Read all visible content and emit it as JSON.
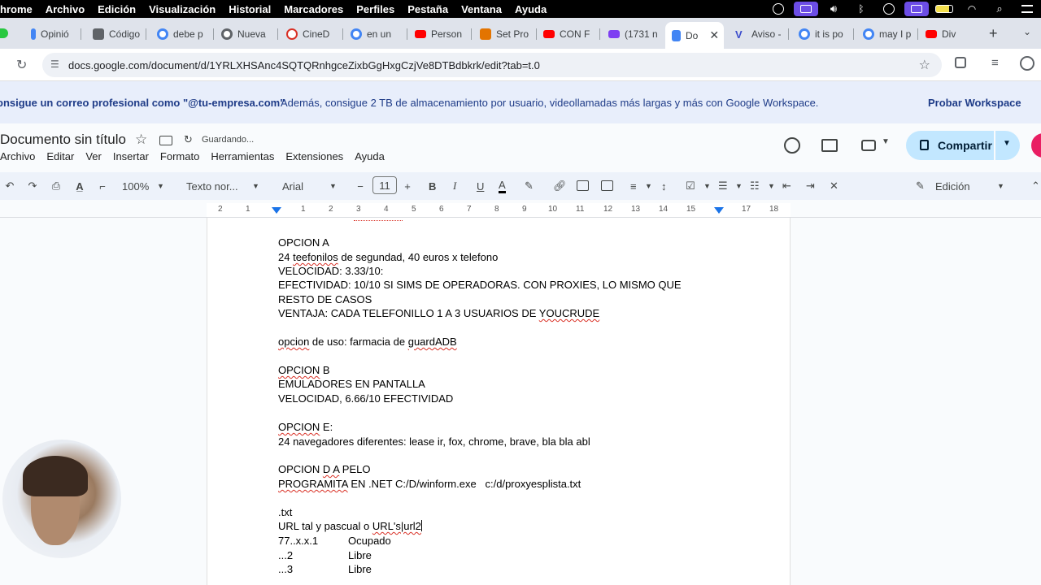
{
  "menubar": {
    "app": "hrome",
    "items": [
      "Archivo",
      "Edición",
      "Visualización",
      "Historial",
      "Marcadores",
      "Perfiles",
      "Pestaña",
      "Ventana",
      "Ayuda"
    ]
  },
  "tabs": [
    {
      "label": "Opinió",
      "color": "#4285f4"
    },
    {
      "label": "Código",
      "color": "#5f6368"
    },
    {
      "label": "debe p",
      "color": "#4285f4"
    },
    {
      "label": "Nueva",
      "color": "#5f6368"
    },
    {
      "label": "CineD",
      "color": "#d93025"
    },
    {
      "label": "en un",
      "color": "#4285f4"
    },
    {
      "label": "Person",
      "color": "#ff0000"
    },
    {
      "label": "Set Pro",
      "color": "#e37400"
    },
    {
      "label": "CON F",
      "color": "#ff0000"
    },
    {
      "label": "(1731 n",
      "color": "#7e3ff2"
    },
    {
      "label": "Do",
      "color": "#4285f4",
      "active": true
    },
    {
      "label": "Aviso -",
      "color": "#3c4dcc"
    },
    {
      "label": "it is po",
      "color": "#4285f4"
    },
    {
      "label": "may I p",
      "color": "#4285f4"
    },
    {
      "label": "Div",
      "color": "#ff0000"
    }
  ],
  "address": {
    "url": "docs.google.com/document/d/1YRLXHSAnc4SQTQRnhgceZixbGgHxgCzjVe8DTBdbkrk/edit?tab=t.0"
  },
  "banner": {
    "bold": "onsigue un correo profesional como \"@tu-empresa.com\"",
    "text": "Además, consigue 2 TB de almacenamiento por usuario, videollamadas más largas y más con Google Workspace.",
    "cta": "Probar Workspace"
  },
  "doc": {
    "title": "Documento sin título",
    "status": "Guardando...",
    "menu": [
      "Archivo",
      "Editar",
      "Ver",
      "Insertar",
      "Formato",
      "Herramientas",
      "Extensiones",
      "Ayuda"
    ],
    "share": "Compartir"
  },
  "toolbar": {
    "zoom": "100%",
    "style": "Texto nor...",
    "font": "Arial",
    "size": "11",
    "mode": "Edición"
  },
  "ruler": [
    "2",
    "1",
    "1",
    "2",
    "3",
    "4",
    "5",
    "6",
    "7",
    "8",
    "9",
    "10",
    "11",
    "12",
    "13",
    "14",
    "15",
    "16",
    "17",
    "18"
  ],
  "body": {
    "l1": "OPCION A",
    "l2a": "24 ",
    "l2b": "teefonilos",
    "l2c": " de segundad, 40 euros x telefono",
    "l3": "VELOCIDAD: 3.33/10:",
    "l4": "EFECTIVIDAD: 10/10 SI SIMS DE OPERADORAS. CON PROXIES, LO MISMO QUE",
    "l5": "RESTO DE CASOS",
    "l6a": "VENTAJA: CADA TELEFONILLO 1 A 3 USUARIOS DE ",
    "l6b": "YOUCRUDE",
    "l7a": "opcion",
    "l7b": " de uso: farmacia de ",
    "l7c": "guardADB",
    "l8a": "OPCION",
    "l8b": " B",
    "l9": "EMULADORES EN PANTALLA",
    "l10": "VELOCIDAD, 6.66/10 EFECTIVIDAD",
    "l11a": "OPCION",
    "l11b": " E:",
    "l12": "24 navegadores diferentes: lease ir, fox, chrome, brave, bla bla abl",
    "l13a": "OPCION ",
    "l13b": "D A",
    "l13c": " PELO",
    "l14a": "PROGRAMITA",
    "l14b": " EN .NET C:/D/winform.exe   c:/d/proxyesplista.txt",
    "l15": ".txt",
    "l16a": "URL tal y pascual o ",
    "l16b": "URL's|url2",
    "l17a": "77..x.x.1",
    "l17b": "Ocupado",
    "l18a": "...2",
    "l18b": "Libre",
    "l19a": "...3",
    "l19b": "Libre"
  },
  "colors": {
    "menubar": "#000000",
    "tabstrip": "#dfe3eb",
    "banner": "#e8eefb",
    "share": "#c2e7ff",
    "toolbar": "#edf2fa",
    "spell": "#d93025"
  }
}
